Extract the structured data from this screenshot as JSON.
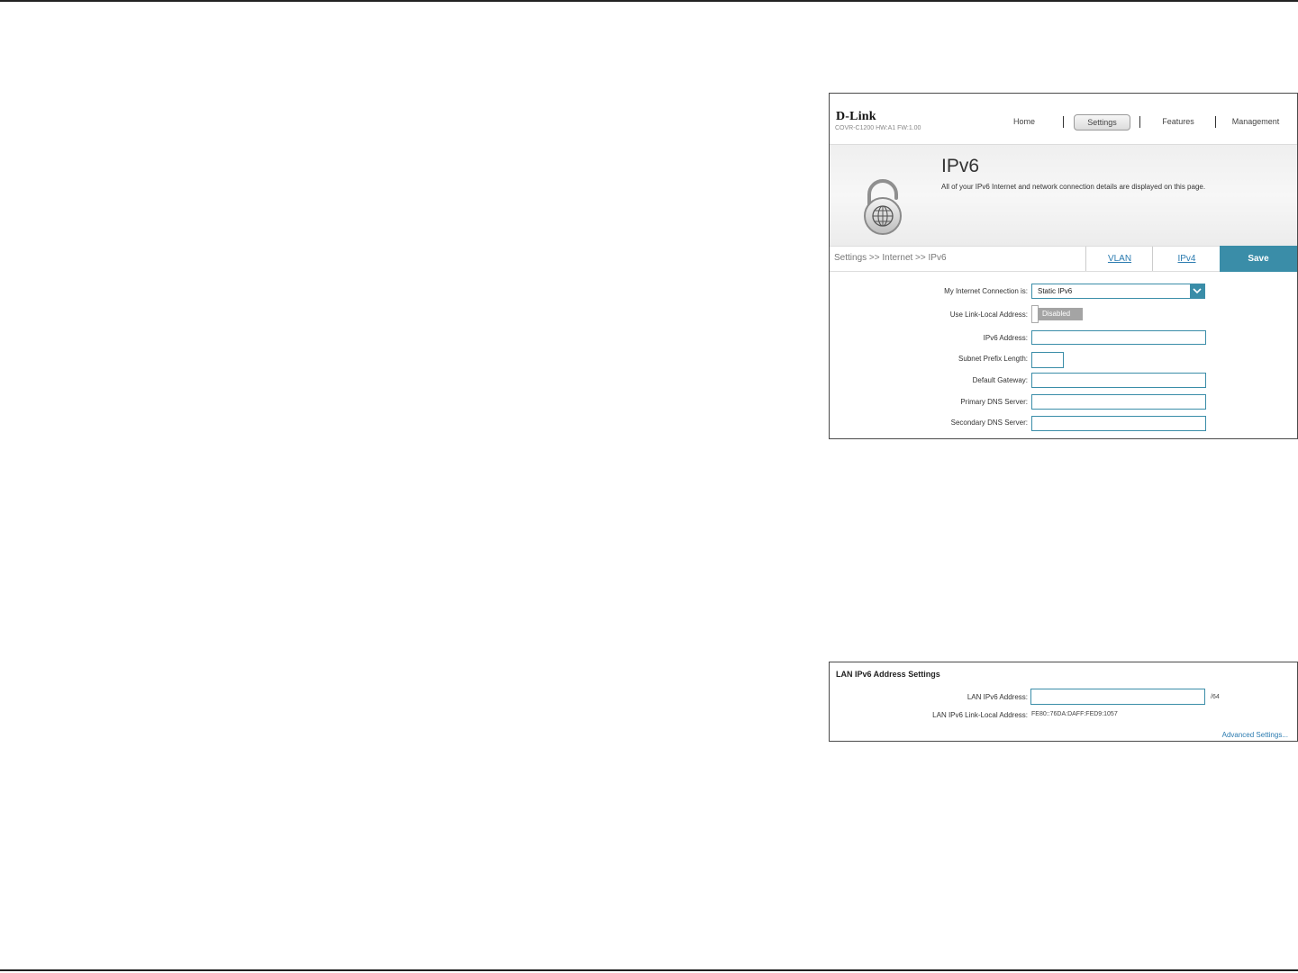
{
  "header": {
    "brand": "D-Link",
    "model_info": "COVR-C1200 HW:A1 FW:1.00",
    "nav": {
      "home": "Home",
      "settings": "Settings",
      "features": "Features",
      "management": "Management"
    }
  },
  "banner": {
    "title": "IPv6",
    "description": "All of your IPv6 Internet and network connection details are displayed on this page.",
    "icon": "lock-globe-icon"
  },
  "breadcrumb": "Settings >> Internet >> IPv6",
  "tabs": {
    "vlan": "VLAN",
    "ipv4": "IPv4",
    "save": "Save"
  },
  "form": {
    "connection_label": "My Internet Connection is:",
    "connection_value": "Static IPv6",
    "link_local_label": "Use Link-Local Address:",
    "link_local_state": "Disabled",
    "ipv6_address_label": "IPv6 Address:",
    "ipv6_address_value": "",
    "prefix_length_label": "Subnet Prefix Length:",
    "prefix_length_value": "",
    "gateway_label": "Default Gateway:",
    "gateway_value": "",
    "primary_dns_label": "Primary DNS Server:",
    "primary_dns_value": "",
    "secondary_dns_label": "Secondary DNS Server:",
    "secondary_dns_value": ""
  },
  "lan": {
    "title": "LAN IPv6 Address Settings",
    "address_label": "LAN IPv6 Address:",
    "address_value": "",
    "address_suffix": "/64",
    "link_local_label": "LAN IPv6 Link-Local Address:",
    "link_local_value": "FE80::76DA:DAFF:FED9:1057",
    "advanced_link": "Advanced Settings..."
  },
  "colors": {
    "accent": "#3a8da8",
    "link": "#2b7bb0"
  }
}
